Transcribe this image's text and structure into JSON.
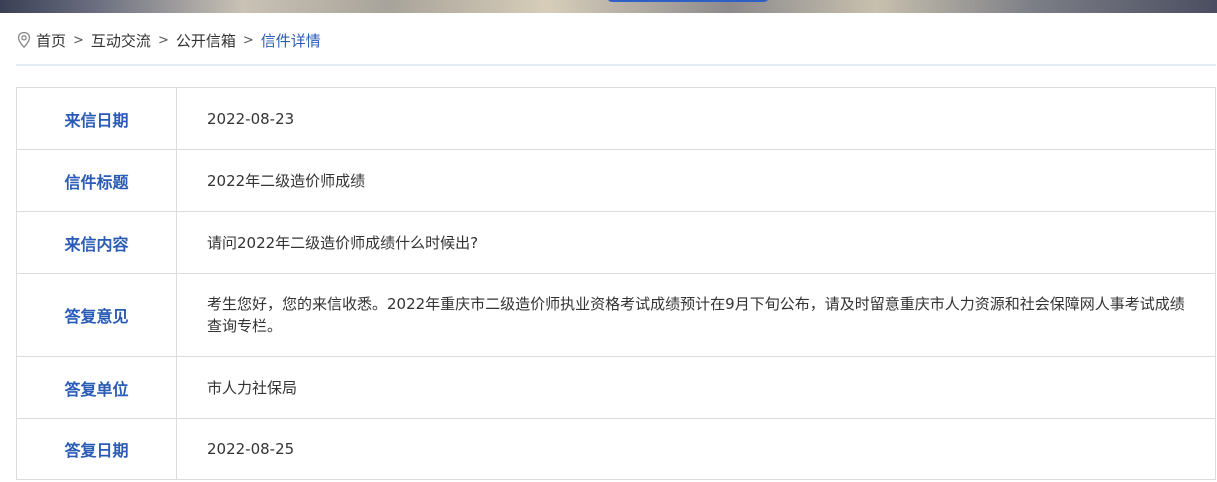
{
  "breadcrumb": {
    "items": [
      "首页",
      "互动交流",
      "公开信箱"
    ],
    "current": "信件详情",
    "separator": ">"
  },
  "details": {
    "rows": [
      {
        "label": "来信日期",
        "value": "2022-08-23"
      },
      {
        "label": "信件标题",
        "value": "2022年二级造价师成绩"
      },
      {
        "label": "来信内容",
        "value": "请问2022年二级造价师成绩什么时候出?"
      },
      {
        "label": "答复意见",
        "value": "考生您好，您的来信收悉。2022年重庆市二级造价师执业资格考试成绩预计在9月下旬公布，请及时留意重庆市人力资源和社会保障网人事考试成绩查询专栏。"
      },
      {
        "label": "答复单位",
        "value": "市人力社保局"
      },
      {
        "label": "答复日期",
        "value": "2022-08-25"
      }
    ]
  },
  "colors": {
    "accent": "#2a5cb5",
    "border": "#dcdcdc"
  }
}
